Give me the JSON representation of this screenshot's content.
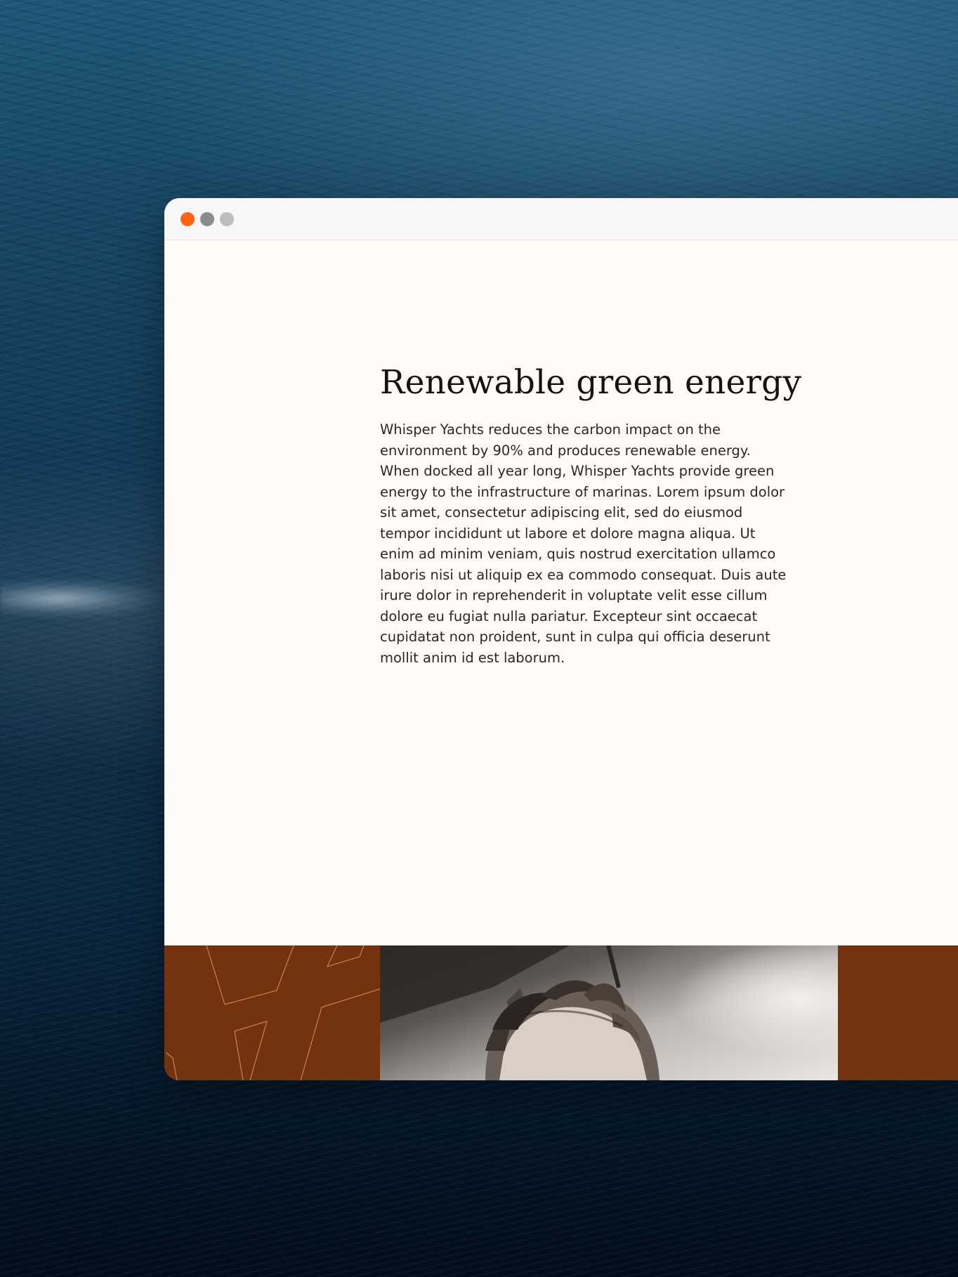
{
  "window": {
    "controls": [
      {
        "name": "close",
        "color": "#ff6411"
      },
      {
        "name": "minimize",
        "color": "#8c8c8c"
      },
      {
        "name": "maximize",
        "color": "#bdbdbd"
      }
    ]
  },
  "section": {
    "heading": "Renewable green energy",
    "body": "Whisper Yachts reduces the carbon impact on the environment by 90% and produces renewable energy. When docked all year long, Whisper Yachts provide green energy to the infrastructure of marinas. Lorem ipsum dolor sit amet, consectetur adipiscing elit, sed do eiusmod tempor incididunt ut labore et dolore magna aliqua. Ut enim ad minim veniam, quis nostrud exercitation ullamco laboris nisi ut aliquip ex ea commodo consequat. Duis aute irure dolor in reprehenderit in voluptate velit esse cillum dolore eu fugiat nulla pariatur. Excepteur sint occaecat cupidatat non proident, sunt in culpa qui officia deserunt mollit anim id est laborum."
  },
  "hero": {
    "brand_color": "#733210",
    "line_color": "#c9824f",
    "image": "grayscale-portrait-man-hair"
  },
  "background": {
    "image": "aerial-ocean-water"
  }
}
